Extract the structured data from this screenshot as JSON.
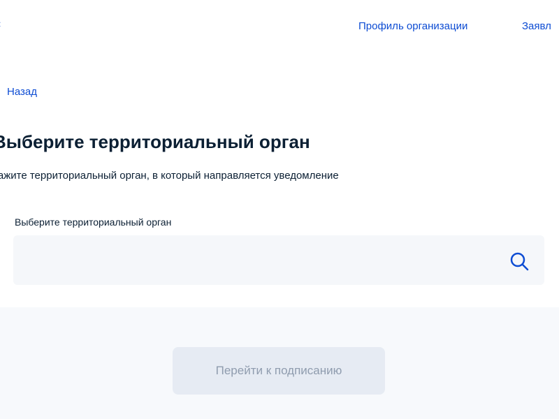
{
  "header": {
    "nav": {
      "profile": "Профиль организации",
      "applications": "Заявл"
    }
  },
  "back": {
    "label": "Назад"
  },
  "main": {
    "title": "Выберите территориальный орган",
    "subtitle": "кажите территориальный орган, в который направляется уведомление",
    "field": {
      "label": "Выберите территориальный орган",
      "value": "",
      "placeholder": ""
    }
  },
  "actions": {
    "sign_label": "Перейти к подписанию",
    "sign_disabled": true
  },
  "icons": {
    "back": "chevron-left-icon",
    "search": "search-icon"
  },
  "colors": {
    "link": "#0d4cd3",
    "text": "#0b1f33",
    "page_background": "#f7f9fc",
    "field_background": "#f5f7fa",
    "button_disabled_background": "#e6ebf3",
    "button_disabled_text": "#8f9cae"
  }
}
